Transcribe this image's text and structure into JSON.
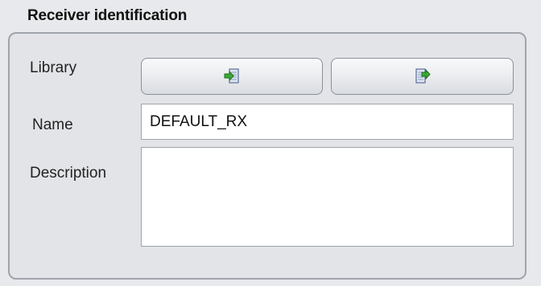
{
  "panel": {
    "title": "Receiver identification",
    "library_label": "Library",
    "name_label": "Name",
    "description_label": "Description"
  },
  "fields": {
    "name_value": "DEFAULT_RX",
    "description_value": ""
  },
  "icons": {
    "import": "import-from-library-icon",
    "export": "export-to-library-icon"
  },
  "colors": {
    "accent_green": "#2e9c2a",
    "background": "#e8e9ec",
    "border": "#9fa4ab"
  }
}
